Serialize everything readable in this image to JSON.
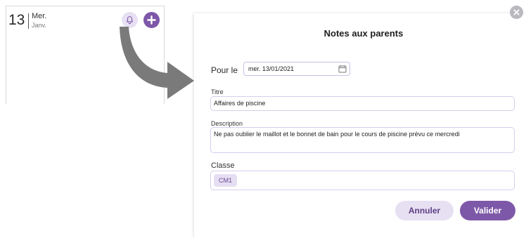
{
  "day_card": {
    "day_number": "13",
    "day_name": "Mer.",
    "month": "Janv."
  },
  "modal": {
    "title": "Notes aux parents",
    "date_label": "Pour le",
    "date_value": "mer. 13/01/2021",
    "title_label": "Titre",
    "title_value": "Affaires de piscine",
    "description_label": "Description",
    "description_value": "Ne pas oublier le maillot et le bonnet de bain pour le cours de piscine prévu ce mercredi",
    "class_label": "Classe",
    "class_chip": "CM1",
    "cancel_label": "Annuler",
    "submit_label": "Valider"
  },
  "icons": {
    "bell": "bell-icon",
    "add": "plus-icon",
    "close": "close-icon",
    "calendar": "calendar-icon",
    "arrow": "curved-arrow-icon"
  },
  "colors": {
    "accent": "#7e58a8",
    "accent_light": "#e7e0f3",
    "field_border": "#d7cdec",
    "close_gray": "#b9b9be"
  }
}
